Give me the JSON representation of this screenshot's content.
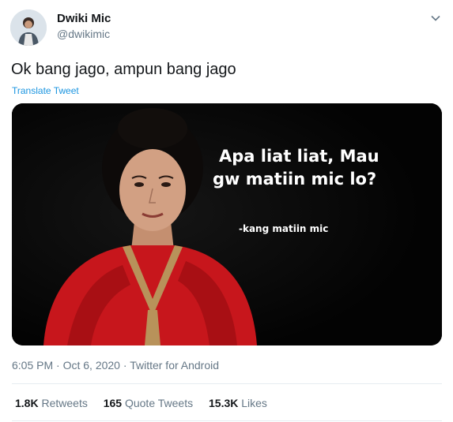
{
  "author": {
    "display_name": "Dwiki Mic",
    "handle": "@dwikimic"
  },
  "tweet": {
    "text": "Ok bang jago, ampun bang jago",
    "translate_label": "Translate Tweet"
  },
  "media": {
    "line1": "Apa liat liat, Mau",
    "line2": "gw matiin mic lo?",
    "credit": "-kang matiin mic"
  },
  "meta": {
    "time": "6:05 PM",
    "separator": "·",
    "date": "Oct 6, 2020",
    "source": "Twitter for Android"
  },
  "stats": {
    "retweets_count": "1.8K",
    "retweets_label": "Retweets",
    "quote_count": "165",
    "quote_label": "Quote Tweets",
    "likes_count": "15.3K",
    "likes_label": "Likes"
  },
  "icons": {
    "avatar": "user-avatar",
    "menu": "chevron-down-icon"
  }
}
